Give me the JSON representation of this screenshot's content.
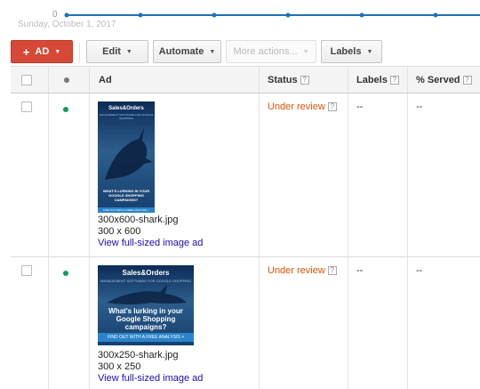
{
  "chart": {
    "zero_label": "0",
    "date_label": "Sunday, October 1, 2017",
    "line_color": "#1a73b5"
  },
  "toolbar": {
    "ad_label": "AD",
    "edit_label": "Edit",
    "automate_label": "Automate",
    "more_actions_label": "More actions...",
    "labels_label": "Labels",
    "accent_color": "#d64937"
  },
  "table": {
    "headers": {
      "ad": "Ad",
      "status": "Status",
      "labels": "Labels",
      "served": "% Served"
    },
    "rows": [
      {
        "filename": "300x600-shark.jpg",
        "size": "300 x 600",
        "link": "View full-sized image ad",
        "status": "Under review",
        "labels": "--",
        "served": "--",
        "ad_creative": {
          "logo": "Sales&Orders",
          "sub": "MANAGEMENT SOFTWARE FOR GOOGLE SHOPPING",
          "headline": "WHAT'S LURKING IN YOUR GOOGLE SHOPPING CAMPAIGNS?",
          "cta": "FIND OUT WITH A FREE ANALYSIS >"
        }
      },
      {
        "filename": "300x250-shark.jpg",
        "size": "300 x 250",
        "link": "View full-sized image ad",
        "status": "Under review",
        "labels": "--",
        "served": "--",
        "ad_creative": {
          "logo": "Sales&Orders",
          "sub": "MANAGEMENT SOFTWARE FOR GOOGLE SHOPPING",
          "headline": "What's lurking in your Google Shopping campaigns?",
          "cta": "FIND OUT WITH A FREE ANALYSIS >"
        }
      }
    ]
  },
  "colors": {
    "status_review": "#e65100",
    "enabled_dot": "#0f9d58",
    "link": "#1a0dab"
  }
}
